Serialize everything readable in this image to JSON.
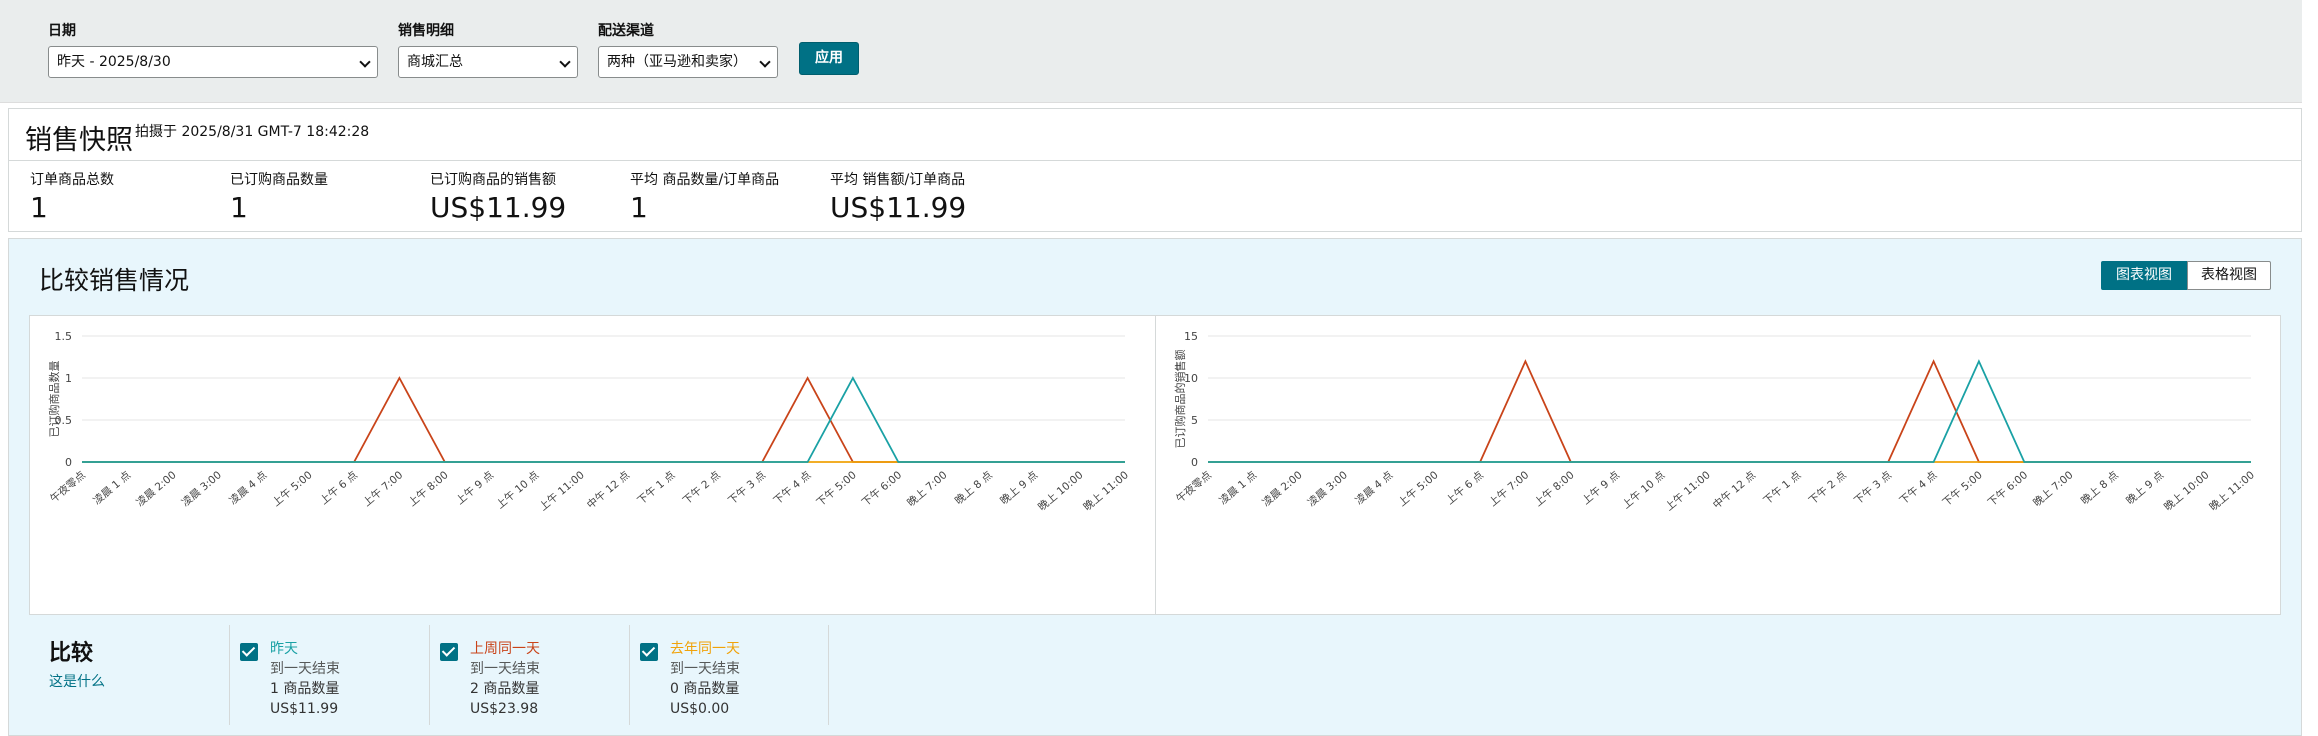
{
  "filters": {
    "date": {
      "label": "日期",
      "value": "昨天 - 2025/8/30"
    },
    "sales_detail": {
      "label": "销售明细",
      "value": "商城汇总"
    },
    "channel": {
      "label": "配送渠道",
      "value": "两种（亚马逊和卖家）"
    },
    "apply_label": "应用"
  },
  "snapshot": {
    "title": "销售快照",
    "timestamp": "拍摄于 2025/8/31 GMT-7 18:42:28",
    "metrics": [
      {
        "label": "订单商品总数",
        "value": "1"
      },
      {
        "label": "已订购商品数量",
        "value": "1"
      },
      {
        "label": "已订购商品的销售额",
        "value": "US$11.99"
      },
      {
        "label": "平均 商品数量/订单商品",
        "value": "1"
      },
      {
        "label": "平均 销售额/订单商品",
        "value": "US$11.99"
      }
    ]
  },
  "compare": {
    "title": "比较销售情况",
    "chart_view_label": "图表视图",
    "table_view_label": "表格视图",
    "legend_title": "比较",
    "whats_this": "这是什么",
    "groups": [
      {
        "title": "昨天",
        "color": "#1aa1a5",
        "sub": "到一天结束",
        "qty": "1 商品数量",
        "amount": "US$11.99"
      },
      {
        "title": "上周同一天",
        "color": "#c9441a",
        "sub": "到一天结束",
        "qty": "2 商品数量",
        "amount": "US$23.98"
      },
      {
        "title": "去年同一天",
        "color": "#f0a30a",
        "sub": "到一天结束",
        "qty": "0 商品数量",
        "amount": "US$0.00"
      }
    ]
  },
  "colors": {
    "yesterday": "#1aa1a5",
    "last_week": "#c9441a",
    "last_year": "#f0a30a",
    "accent": "#007185"
  },
  "chart_data": [
    {
      "type": "line",
      "ylabel": "已订购商品数量",
      "ylim": [
        0,
        1.5
      ],
      "yticks": [
        "0",
        "0.5",
        "1",
        "1.5"
      ],
      "categories": [
        "午夜零点",
        "凌晨 1 点",
        "凌晨 2:00",
        "凌晨 3:00",
        "凌晨 4 点",
        "上午 5:00",
        "上午 6 点",
        "上午 7:00",
        "上午 8:00",
        "上午 9 点",
        "上午 10 点",
        "上午 11:00",
        "中午 12 点",
        "下午 1 点",
        "下午 2 点",
        "下午 3 点",
        "下午 4 点",
        "下午 5:00",
        "下午 6:00",
        "晚上 7:00",
        "晚上 8 点",
        "晚上 9 点",
        "晚上 10:00",
        "晚上 11:00"
      ],
      "series": [
        {
          "name": "上周同一天",
          "color": "#c9441a",
          "values": [
            0,
            0,
            0,
            0,
            0,
            0,
            0,
            1,
            0,
            0,
            0,
            0,
            0,
            0,
            0,
            0,
            1,
            0,
            0,
            0,
            0,
            0,
            0,
            0
          ]
        },
        {
          "name": "去年同一天",
          "color": "#f0a30a",
          "values": [
            0,
            0,
            0,
            0,
            0,
            0,
            0,
            0,
            0,
            0,
            0,
            0,
            0,
            0,
            0,
            0,
            0,
            0,
            0,
            0,
            0,
            0,
            0,
            0
          ]
        },
        {
          "name": "昨天",
          "color": "#1aa1a5",
          "values": [
            0,
            0,
            0,
            0,
            0,
            0,
            0,
            0,
            0,
            0,
            0,
            0,
            0,
            0,
            0,
            0,
            0,
            1,
            0,
            0,
            0,
            0,
            0,
            0
          ]
        }
      ]
    },
    {
      "type": "line",
      "ylabel": "已订购商品的销售额",
      "ylim": [
        0,
        15
      ],
      "yticks": [
        "0",
        "5",
        "10",
        "15"
      ],
      "categories": [
        "午夜零点",
        "凌晨 1 点",
        "凌晨 2:00",
        "凌晨 3:00",
        "凌晨 4 点",
        "上午 5:00",
        "上午 6 点",
        "上午 7:00",
        "上午 8:00",
        "上午 9 点",
        "上午 10 点",
        "上午 11:00",
        "中午 12 点",
        "下午 1 点",
        "下午 2 点",
        "下午 3 点",
        "下午 4 点",
        "下午 5:00",
        "下午 6:00",
        "晚上 7:00",
        "晚上 8 点",
        "晚上 9 点",
        "晚上 10:00",
        "晚上 11:00"
      ],
      "series": [
        {
          "name": "上周同一天",
          "color": "#c9441a",
          "values": [
            0,
            0,
            0,
            0,
            0,
            0,
            0,
            11.99,
            0,
            0,
            0,
            0,
            0,
            0,
            0,
            0,
            11.99,
            0,
            0,
            0,
            0,
            0,
            0,
            0
          ]
        },
        {
          "name": "去年同一天",
          "color": "#f0a30a",
          "values": [
            0,
            0,
            0,
            0,
            0,
            0,
            0,
            0,
            0,
            0,
            0,
            0,
            0,
            0,
            0,
            0,
            0,
            0,
            0,
            0,
            0,
            0,
            0,
            0
          ]
        },
        {
          "name": "昨天",
          "color": "#1aa1a5",
          "values": [
            0,
            0,
            0,
            0,
            0,
            0,
            0,
            0,
            0,
            0,
            0,
            0,
            0,
            0,
            0,
            0,
            0,
            11.99,
            0,
            0,
            0,
            0,
            0,
            0
          ]
        }
      ]
    }
  ]
}
